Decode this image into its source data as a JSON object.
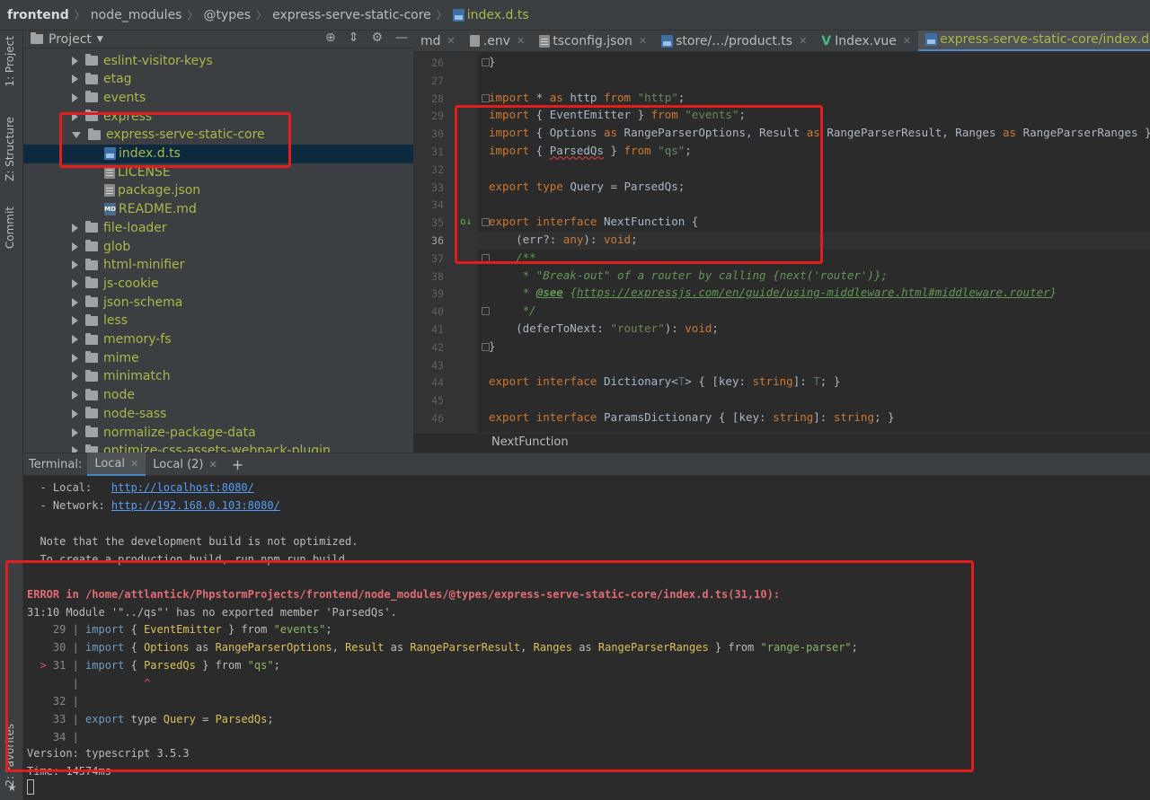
{
  "breadcrumb": {
    "items": [
      "frontend",
      "node_modules",
      "@types",
      "express-serve-static-core"
    ],
    "file": "index.d.ts"
  },
  "left_strip": {
    "project": "1: Project",
    "structure": "Z: Structure",
    "commit": "Commit",
    "favorites": "2: Favorites"
  },
  "project_panel": {
    "title": "Project",
    "tree": [
      {
        "label": "eslint-visitor-keys",
        "type": "folder"
      },
      {
        "label": "etag",
        "type": "folder"
      },
      {
        "label": "events",
        "type": "folder"
      },
      {
        "label": "express",
        "type": "folder"
      },
      {
        "label": "express-serve-static-core",
        "type": "folder-open"
      },
      {
        "label": "index.d.ts",
        "type": "ts",
        "selected": true
      },
      {
        "label": "LICENSE",
        "type": "txt"
      },
      {
        "label": "package.json",
        "type": "txt"
      },
      {
        "label": "README.md",
        "type": "md"
      },
      {
        "label": "file-loader",
        "type": "folder"
      },
      {
        "label": "glob",
        "type": "folder"
      },
      {
        "label": "html-minifier",
        "type": "folder"
      },
      {
        "label": "js-cookie",
        "type": "folder"
      },
      {
        "label": "json-schema",
        "type": "folder"
      },
      {
        "label": "less",
        "type": "folder"
      },
      {
        "label": "memory-fs",
        "type": "folder"
      },
      {
        "label": "mime",
        "type": "folder"
      },
      {
        "label": "minimatch",
        "type": "folder"
      },
      {
        "label": "node",
        "type": "folder"
      },
      {
        "label": "node-sass",
        "type": "folder"
      },
      {
        "label": "normalize-package-data",
        "type": "folder"
      },
      {
        "label": "optimize-css-assets-webpack-plugin",
        "type": "folder"
      }
    ]
  },
  "editor_tabs": [
    {
      "label": "md",
      "icon": "none"
    },
    {
      "label": ".env",
      "icon": "env"
    },
    {
      "label": "tsconfig.json",
      "icon": "txt"
    },
    {
      "label": "store/…/product.ts",
      "icon": "ts"
    },
    {
      "label": "Index.vue",
      "icon": "vue"
    },
    {
      "label": "express-serve-static-core/index.d.ts",
      "icon": "ts",
      "active": true
    }
  ],
  "editor": {
    "current_line": 36,
    "line_numbers": [
      "26",
      "27",
      "28",
      "29",
      "30",
      "31",
      "32",
      "33",
      "34",
      "35",
      "36",
      "37",
      "38",
      "39",
      "40",
      "41",
      "42",
      "43",
      "44",
      "45",
      "46"
    ],
    "code": [
      "}",
      "",
      "import * as http from \"http\";",
      "import { EventEmitter } from \"events\";",
      "import { Options as RangeParserOptions, Result as RangeParserResult, Ranges as RangeParserRanges } from \"ran",
      "import { ParsedQs } from \"qs\";",
      "",
      "export type Query = ParsedQs;",
      "",
      "export interface NextFunction {",
      "    (err?: any): void;",
      "    /**",
      "     * \"Break-out\" of a router by calling {next('router')};",
      "     * @see {https://expressjs.com/en/guide/using-middleware.html#middleware.router}",
      "     */",
      "    (deferToNext: \"router\"): void;",
      "}",
      "",
      "export interface Dictionary<T> { [key: string]: T; }",
      "",
      "export interface ParamsDictionary { [key: string]: string; }"
    ],
    "structure_crumb": "NextFunction"
  },
  "terminal": {
    "label": "Terminal:",
    "tabs": [
      {
        "label": "Local",
        "active": true
      },
      {
        "label": "Local (2)"
      }
    ],
    "add": "+",
    "lines": [
      {
        "kind": "url",
        "prefix": "  - Local:   ",
        "url": "http://localhost:8080/"
      },
      {
        "kind": "url",
        "prefix": "  - Network: ",
        "url": "http://192.168.0.103:8080/"
      },
      {
        "kind": "plain",
        "text": "  Note that the development build is not optimized."
      },
      {
        "kind": "plain",
        "text": "  To create a production build, run npm run build."
      }
    ],
    "error_header": "ERROR in /home/attlantick/PhpstormProjects/frontend/node_modules/@types/express-serve-static-core/index.d.ts(31,10):",
    "error_message": "31:10 Module '\"../qs\"' has no exported member 'ParsedQs'.",
    "error_lines": [
      {
        "marker": "  ",
        "num": "29",
        "code": "import { EventEmitter } from \"events\";"
      },
      {
        "marker": "  ",
        "num": "30",
        "code": "import { Options as RangeParserOptions, Result as RangeParserResult, Ranges as RangeParserRanges } from \"range-parser\";"
      },
      {
        "marker": "> ",
        "num": "31",
        "code": "import { ParsedQs } from \"qs\";"
      },
      {
        "marker": "  ",
        "num": "  ",
        "code": "         ^"
      },
      {
        "marker": "  ",
        "num": "32",
        "code": ""
      },
      {
        "marker": "  ",
        "num": "33",
        "code": "export type Query = ParsedQs;"
      },
      {
        "marker": "  ",
        "num": "34",
        "code": ""
      }
    ],
    "version": "Version: typescript 3.5.3",
    "time": "Time: 14574ms"
  },
  "colors": {
    "highlight_box": "#e31c1c",
    "accent": "#4a88c7"
  }
}
